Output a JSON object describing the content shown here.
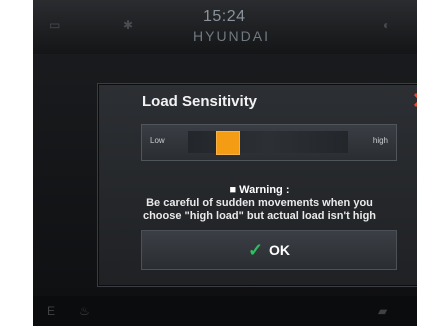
{
  "status": {
    "time": "15:24",
    "brand": "HYUNDAI"
  },
  "dialog": {
    "title": "Load Sensitivity",
    "close_icon": "close-icon",
    "slider": {
      "low_label": "Low",
      "high_label": "high",
      "level": 0.2
    },
    "warning": {
      "heading": "■ Warning :",
      "line1": "Be careful of sudden movements when you",
      "line2": "choose \"high load\" but actual load isn't high"
    },
    "ok_label": "OK",
    "ok_icon": "check-icon"
  },
  "colors": {
    "accent": "#f39c14",
    "close": "#e64a2e",
    "check": "#2fbf5f"
  }
}
